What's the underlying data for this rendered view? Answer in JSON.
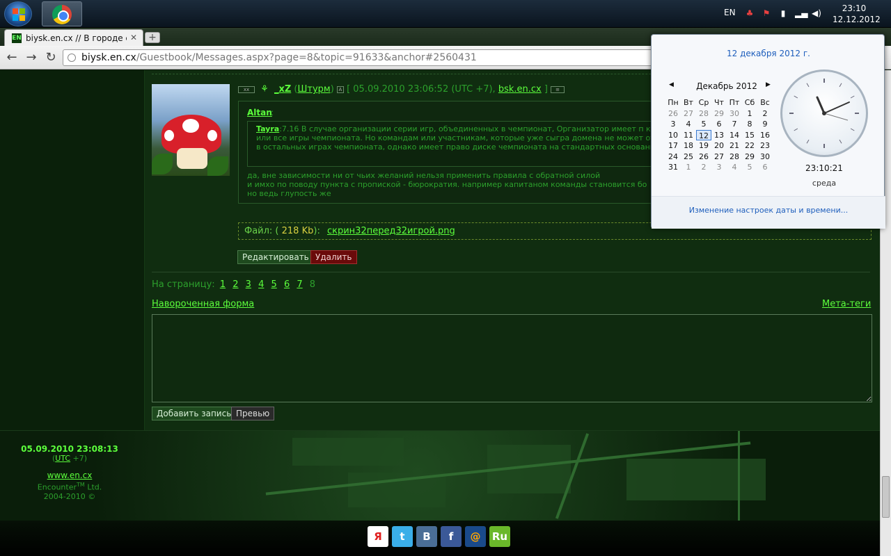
{
  "taskbar": {
    "language": "EN",
    "time": "23:10",
    "date": "12.12.2012"
  },
  "browser": {
    "tab_title": "biysk.en.cx // В городе с...",
    "tab_favicon": "EN",
    "url_host": "biysk.en.cx",
    "url_path": "/Guestbook/Messages.aspx?page=8&topic=91633&anchor#2560431"
  },
  "post": {
    "nick": "_xZ",
    "team": "Штурм",
    "date_text": "[ 05.09.2010 23:06:52 (UTC +7),",
    "site": "bsk.en.cx",
    "close_bracket": "]",
    "quote_author": "Altan",
    "inner_author": "Tayra",
    "inner_text": ":7.16 В случае организации серии игр, объединенных в чемпионат, Организатор имеет п команды на любую или все игры чемпионата. Но командам или участникам, которые уже сыгра домена не может отказать в участии в остальных играх чемпионата, однако имеет право диске чемпионата на стандартных основаниях.",
    "reply_lines": [
      "да, вне зависимости ни от чьих желаний нельзя применить правила с обратной силой",
      "и имхо по поводу пункта с пропиской -  бюрократия. например капитаном команды становится бо",
      "но ведь глупость же"
    ],
    "file_label": "Файл: (",
    "file_size": "218 Kb",
    "file_close": "):",
    "file_name": "скрин32перед32игрой.png",
    "edit_label": "Редактировать",
    "delete_label": "Удалить"
  },
  "pager": {
    "label": "На страницу:",
    "pages": [
      "1",
      "2",
      "3",
      "4",
      "5",
      "6",
      "7"
    ],
    "current": "8"
  },
  "form": {
    "fancy_form": "Навороченная форма",
    "meta_tags": "Мета-теги",
    "add_label": "Добавить запись",
    "preview_label": "Превью"
  },
  "footer": {
    "date": "05.09.2010 23:08:13",
    "utc_open": "(",
    "utc": "UTC",
    "utc_rest": "+7)",
    "site": "www.en.cx",
    "company": "Encounter",
    "tm": "TM",
    "company_rest": "Ltd.",
    "years": "2004-2010 ©"
  },
  "share": [
    {
      "name": "yandex",
      "glyph": "Я",
      "color": "#ffffff",
      "text": "#e02020"
    },
    {
      "name": "twitter",
      "glyph": "t",
      "color": "#3aaee8",
      "text": "#ffffff"
    },
    {
      "name": "vkontakte",
      "glyph": "B",
      "color": "#4a6e96",
      "text": "#ffffff"
    },
    {
      "name": "facebook",
      "glyph": "f",
      "color": "#3b5998",
      "text": "#ffffff"
    },
    {
      "name": "mail",
      "glyph": "@",
      "color": "#1a4a8a",
      "text": "#ffa500"
    },
    {
      "name": "liveinternet",
      "glyph": "Ru",
      "color": "#6ab82a",
      "text": "#ffffff"
    }
  ],
  "calendar": {
    "header": "12 декабря 2012 г.",
    "month": "Декабрь 2012",
    "weekdays": [
      "Пн",
      "Вт",
      "Ср",
      "Чт",
      "Пт",
      "Сб",
      "Вс"
    ],
    "weeks": [
      [
        "26",
        "27",
        "28",
        "29",
        "30",
        "1",
        "2"
      ],
      [
        "3",
        "4",
        "5",
        "6",
        "7",
        "8",
        "9"
      ],
      [
        "10",
        "11",
        "12",
        "13",
        "14",
        "15",
        "16"
      ],
      [
        "17",
        "18",
        "19",
        "20",
        "21",
        "22",
        "23"
      ],
      [
        "24",
        "25",
        "26",
        "27",
        "28",
        "29",
        "30"
      ],
      [
        "31",
        "1",
        "2",
        "3",
        "4",
        "5",
        "6"
      ]
    ],
    "muted_first_row": 5,
    "muted_last_row_from": 1,
    "today": "12",
    "time": "23:10:21",
    "day": "среда",
    "settings_link": "Изменение настроек даты и времени..."
  },
  "colors": {
    "page_bg": "#102d10",
    "link": "#5cff3c",
    "text": "#2ca02c",
    "accent_yellow": "#d8d040",
    "delete_red": "#6a0a0a"
  }
}
